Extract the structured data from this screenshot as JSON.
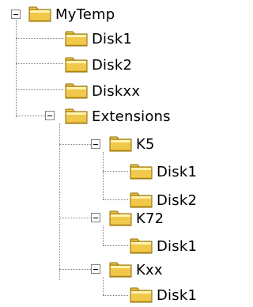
{
  "tree": {
    "root": {
      "label": "MyTemp",
      "children": [
        {
          "label": "Disk1"
        },
        {
          "label": "Disk2"
        },
        {
          "label": "Diskxx"
        },
        {
          "label": "Extensions",
          "children": [
            {
              "label": "K5",
              "children": [
                {
                  "label": "Disk1"
                },
                {
                  "label": "Disk2"
                }
              ]
            },
            {
              "label": "K72",
              "children": [
                {
                  "label": "Disk1"
                }
              ]
            },
            {
              "label": "Kxx",
              "children": [
                {
                  "label": "Disk1"
                }
              ]
            }
          ]
        }
      ]
    }
  },
  "icons": {
    "folder": "folder-icon",
    "collapse": "collapse-icon"
  },
  "colors": {
    "folder_fill": "#f2c84b",
    "folder_outline": "#8a6a00",
    "connector": "#808080"
  }
}
